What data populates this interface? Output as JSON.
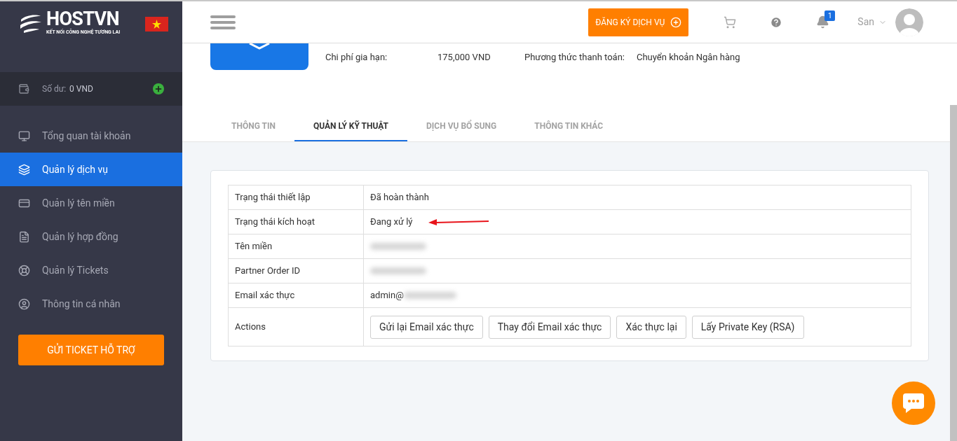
{
  "brand": {
    "name": "HOSTVN",
    "tagline": "KẾT NỐI CÔNG NGHỆ TƯƠNG LAI"
  },
  "balance": {
    "label": "Số dư:",
    "value": "0 VND"
  },
  "sidebar": {
    "items": [
      {
        "label": "Tổng quan tài khoản",
        "selected": false
      },
      {
        "label": "Quản lý dịch vụ",
        "selected": true
      },
      {
        "label": "Quản lý tên miền",
        "selected": false
      },
      {
        "label": "Quản lý hợp đồng",
        "selected": false
      },
      {
        "label": "Quản lý Tickets",
        "selected": false
      },
      {
        "label": "Thông tin cá nhân",
        "selected": false
      }
    ],
    "ticket_button": "GỬI TICKET HỖ TRỢ"
  },
  "header": {
    "register_button": "ĐĂNG KÝ DỊCH VỤ",
    "notifications": "1",
    "user": "San"
  },
  "service": {
    "renewal_label": "Chi phí gia hạn:",
    "renewal_value": "175,000 VND",
    "payment_label": "Phương thức thanh toán:",
    "payment_value": "Chuyển khoản Ngân hàng"
  },
  "tabs": [
    {
      "label": "THÔNG TIN",
      "selected": false
    },
    {
      "label": "QUẢN LÝ KỸ THUẬT",
      "selected": true
    },
    {
      "label": "DỊCH VỤ BỔ SUNG",
      "selected": false
    },
    {
      "label": "THÔNG TIN KHÁC",
      "selected": false
    }
  ],
  "table": {
    "rows": [
      {
        "label": "Trạng thái thiết lập",
        "value": "Đã hoàn thành",
        "redacted": false,
        "arrow": false
      },
      {
        "label": "Trạng thái kích hoạt",
        "value": "Đang xử lý",
        "redacted": false,
        "arrow": true
      },
      {
        "label": "Tên miền",
        "redacted": true,
        "arrow": false
      },
      {
        "label": "Partner Order ID",
        "redacted": true,
        "arrow": false
      },
      {
        "label": "Email xác thực",
        "value": "admin@",
        "redacted": true,
        "arrow": false
      }
    ],
    "actions_label": "Actions",
    "actions": [
      "Gửi lại Email xác thực",
      "Thay đổi Email xác thực",
      "Xác thực lại",
      "Lấy Private Key (RSA)"
    ]
  }
}
